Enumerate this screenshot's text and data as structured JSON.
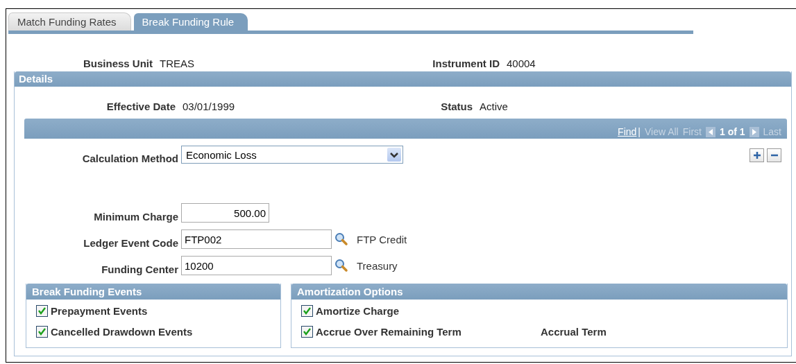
{
  "tabs": [
    {
      "label": "Match Funding Rates",
      "selected": false
    },
    {
      "label": "Break Funding Rule",
      "selected": true
    }
  ],
  "header": [
    {
      "label": "Business Unit",
      "value": "TREAS"
    },
    {
      "label": "Instrument ID",
      "value": "40004"
    }
  ],
  "details": {
    "title": "Details",
    "info": [
      {
        "label": "Effective Date",
        "value": "03/01/1999"
      },
      {
        "label": "Status",
        "value": "Active"
      }
    ],
    "nav": {
      "find": "Find",
      "separator": "|",
      "view_all": "View All",
      "first": "First",
      "counter": "1 of 1",
      "last": "Last"
    },
    "calculation_method": {
      "label": "Calculation Method",
      "value": "Economic Loss"
    },
    "fields": [
      {
        "label": "Minimum Charge",
        "value": "500.00",
        "kind": "amount"
      },
      {
        "label": "Ledger Event Code",
        "value": "FTP002",
        "kind": "lookup",
        "description": "FTP Credit"
      },
      {
        "label": "Funding Center",
        "value": "10200",
        "kind": "lookup",
        "description": "Treasury"
      }
    ],
    "groups": [
      {
        "title": "Break Funding Events",
        "items": [
          {
            "label": "Prepayment Events",
            "checked": true
          },
          {
            "label": "Cancelled Drawdown Events",
            "checked": true
          }
        ]
      },
      {
        "title": "Amortization Options",
        "items": [
          {
            "label": "Amortize Charge",
            "checked": true
          },
          {
            "label": "Accrue Over Remaining Term",
            "checked": true,
            "note": "Accrual Term"
          }
        ]
      }
    ]
  }
}
